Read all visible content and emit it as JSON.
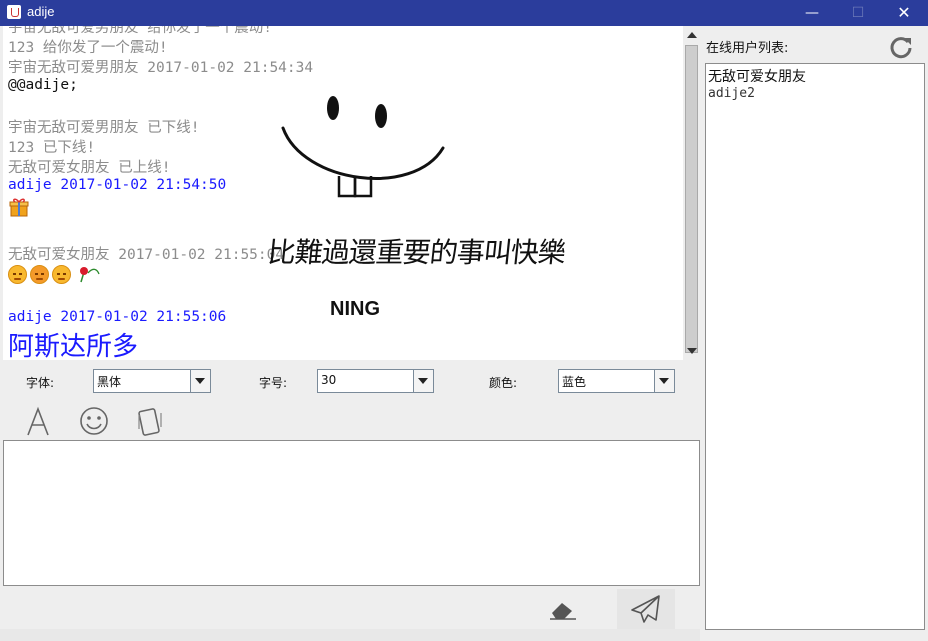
{
  "window": {
    "title": "adije",
    "min_glyph": "—",
    "max_glyph": "☐",
    "close_glyph": "✕"
  },
  "chat": {
    "messages": [
      {
        "text": "宇宙无敌可爱男朋友 给你发了一个震动!",
        "color": "gray"
      },
      {
        "text": "123 给你发了一个震动!",
        "color": "gray"
      },
      {
        "text": "宇宙无敌可爱男朋友 2017-01-02 21:54:34",
        "color": "gray"
      },
      {
        "text": "@@adije;",
        "color": "black"
      },
      {
        "text": "宇宙无敌可爱男朋友 已下线!",
        "color": "gray"
      },
      {
        "text": "123 已下线!",
        "color": "gray"
      },
      {
        "text": "无敌可爱女朋友 已上线!",
        "color": "gray"
      },
      {
        "text": "adije 2017-01-02 21:54:50",
        "color": "blue"
      },
      {
        "text": "无敌可爱女朋友 2017-01-02 21:55:04",
        "color": "gray"
      },
      {
        "text": "adije 2017-01-02 21:55:06",
        "color": "blue"
      },
      {
        "text": "阿斯达所多",
        "color": "blue",
        "large": true
      }
    ],
    "image_caption": "比難過還重要的事叫快樂",
    "image_signature": "NING",
    "icons": [
      "gift-emoji",
      "smile-emoji",
      "angry-emoji",
      "smile-emoji",
      "rose-emoji"
    ]
  },
  "controls": {
    "font_label": "字体:",
    "font_value": "黑体",
    "size_label": "字号:",
    "size_value": "30",
    "color_label": "颜色:",
    "color_value": "蓝色"
  },
  "toolbar_icons": [
    "font-icon",
    "emoji-icon",
    "shake-icon"
  ],
  "actions_icons": [
    "clear-icon",
    "send-icon"
  ],
  "sidebar": {
    "title": "在线用户列表:",
    "users": [
      "无敌可爱女朋友",
      "adije2"
    ]
  },
  "colors": {
    "titlebar": "#2b3d9c",
    "system_text": "#8c8c8c",
    "self_text": "#1a1aff"
  }
}
